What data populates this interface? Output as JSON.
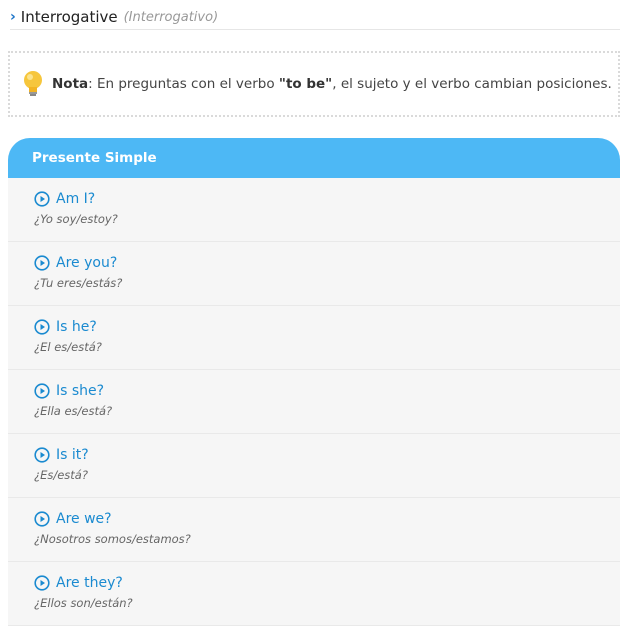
{
  "header": {
    "title": "Interrogative",
    "subtitle": "(Interrogativo)"
  },
  "note": {
    "label": "Nota",
    "text_1": ": En preguntas con el verbo ",
    "highlight": "\"to be\"",
    "text_2": ", el sujeto y el verbo cambian posiciones."
  },
  "table": {
    "heading": "Presente Simple",
    "rows": [
      {
        "en": "Am I?",
        "es": "¿Yo soy/estoy?"
      },
      {
        "en": "Are you?",
        "es": "¿Tu eres/estás?"
      },
      {
        "en": "Is he?",
        "es": "¿El es/está?"
      },
      {
        "en": "Is she?",
        "es": "¿Ella es/está?"
      },
      {
        "en": "Is it?",
        "es": "¿Es/está?"
      },
      {
        "en": "Are we?",
        "es": "¿Nosotros somos/estamos?"
      },
      {
        "en": "Are they?",
        "es": "¿Ellos son/están?"
      }
    ]
  },
  "icons": {
    "section": "chevron-right-icon",
    "note": "lightbulb-icon",
    "audio": "play-circle-icon"
  },
  "colors": {
    "accent": "#4db8f5",
    "link": "#1a8ad0"
  }
}
